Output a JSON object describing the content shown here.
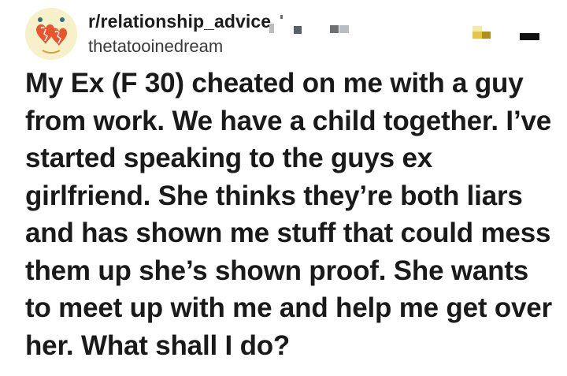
{
  "post": {
    "subreddit": "r/relationship_advice",
    "username": "thetatooinedream",
    "title": "My Ex (F 30) cheated on me with a guy from work. We have a child together. I’ve started speaking to the guys ex girlfriend. She thinks they’re both liars and has shown me stuff that could mess them up she’s shown proof. She wants to meet up with me and help me get over her. What shall I do?"
  },
  "icons": {
    "avatar": "subreddit-hearts-avatar-icon"
  },
  "colors": {
    "background": "#ffffff",
    "text": "#1a1a1b",
    "avatar_bg": "#f6f1c8",
    "avatar_accent": "#e8542e"
  }
}
